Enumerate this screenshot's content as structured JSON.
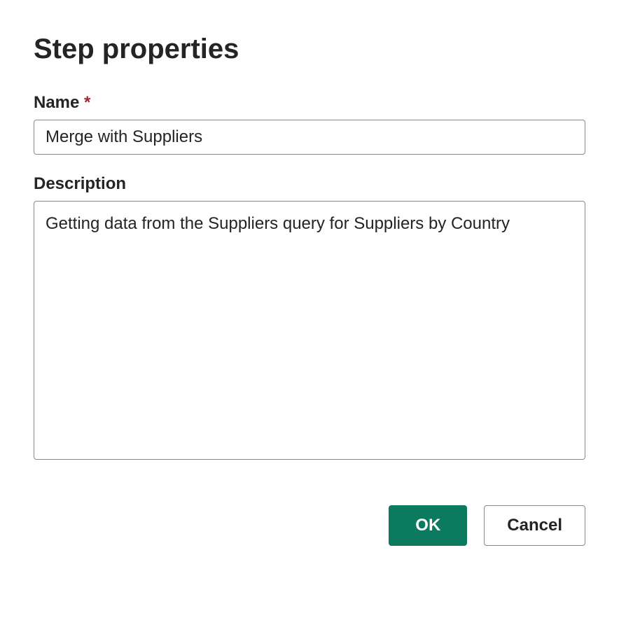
{
  "dialog": {
    "title": "Step properties",
    "name_label": "Name",
    "required_indicator": "*",
    "name_value": "Merge with Suppliers",
    "description_label": "Description",
    "description_value": "Getting data from the Suppliers query for Suppliers by Country",
    "ok_label": "OK",
    "cancel_label": "Cancel"
  }
}
